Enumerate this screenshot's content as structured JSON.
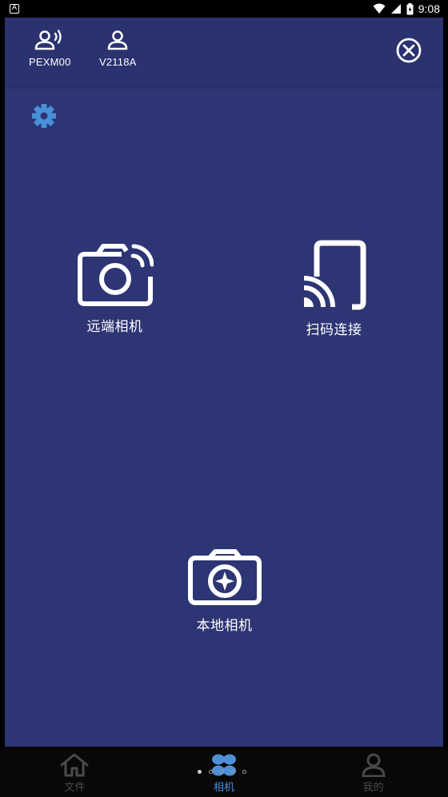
{
  "status_bar": {
    "app_badge": "A",
    "time": "9:08"
  },
  "topbar": {
    "devices": [
      {
        "icon": "remote-user-icon",
        "label": "PEXM00"
      },
      {
        "icon": "user-icon",
        "label": "V2118A"
      }
    ],
    "close_icon": "close-circle-icon"
  },
  "settings_icon": "gear-icon",
  "tiles": {
    "remote_camera": {
      "label": "远端相机",
      "icon": "camera-signal-icon"
    },
    "scan_connect": {
      "label": "扫码连接",
      "icon": "cast-icon"
    },
    "local_camera": {
      "label": "本地相机",
      "icon": "camera-star-icon"
    }
  },
  "bottom_nav": {
    "items": [
      {
        "label": "文件",
        "icon": "home-icon",
        "active": false
      },
      {
        "label": "相机",
        "icon": "flower-icon",
        "active": true
      },
      {
        "label": "我的",
        "icon": "person-icon",
        "active": false
      }
    ],
    "page_indicator": {
      "count": 5,
      "current": 1
    }
  },
  "colors": {
    "background": "#2d3574",
    "topbar": "#2b3270",
    "accent": "#4f8fd8",
    "gear": "#4a90d9",
    "nav_background": "#080808"
  }
}
